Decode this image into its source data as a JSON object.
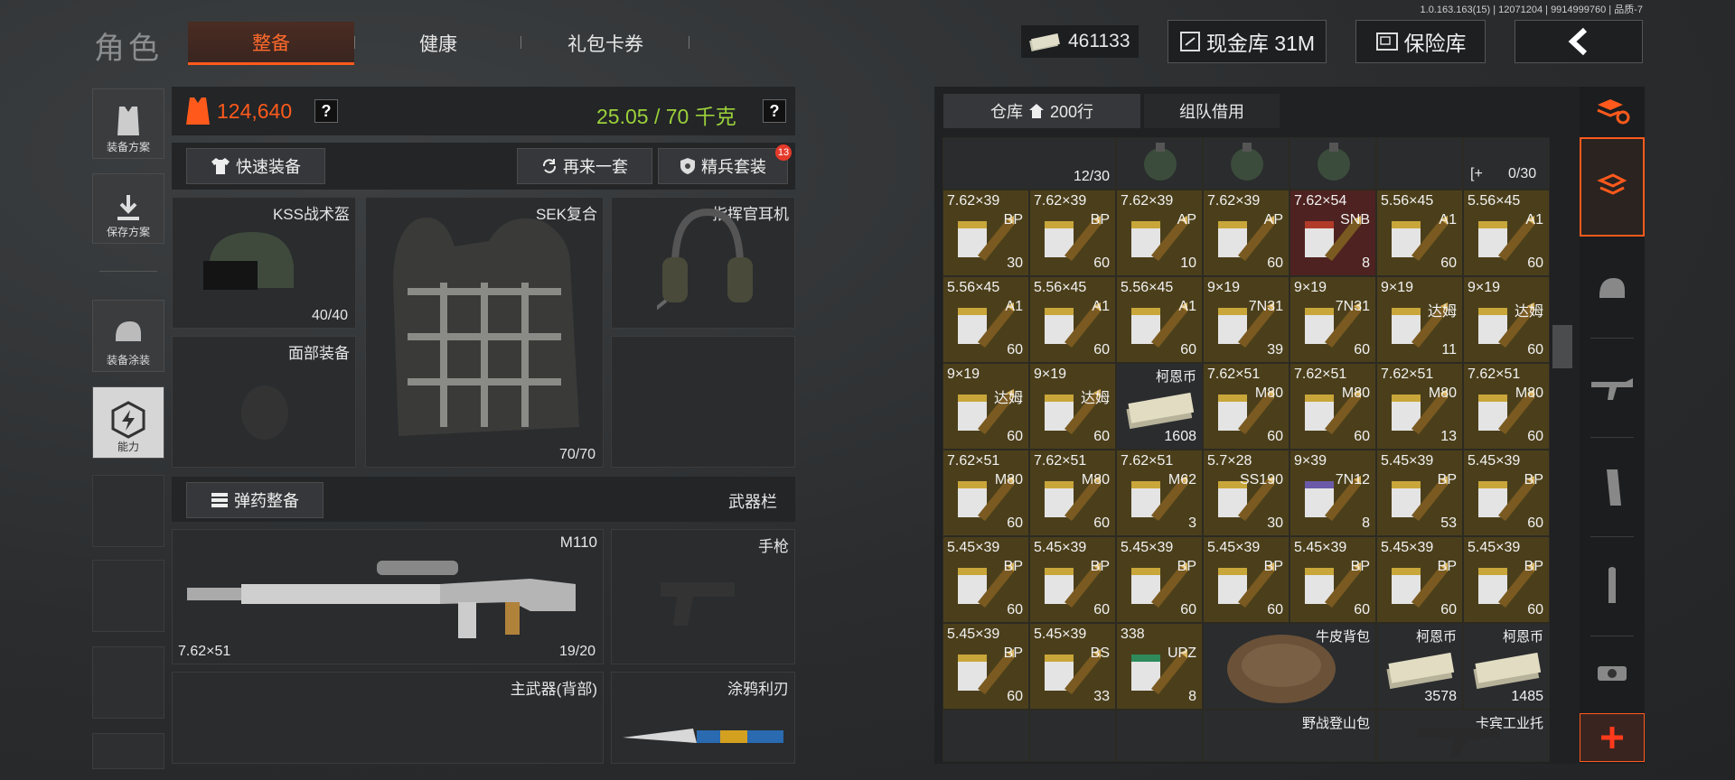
{
  "version": "1.0.163.163(15) | 12071204 | 9914999760 | 品质-7",
  "page_title": "角色",
  "tabs": [
    {
      "label": "整备",
      "active": true
    },
    {
      "label": "健康",
      "active": false
    },
    {
      "label": "礼包卡券",
      "active": false
    }
  ],
  "header": {
    "money": "461133",
    "cash_vault": "现金库 31M",
    "safe": "保险库"
  },
  "side_nav": [
    {
      "label": "装备方案",
      "icon": "vest-plan-icon"
    },
    {
      "label": "保存方案",
      "icon": "download-icon"
    },
    {
      "label": "装备涂装",
      "icon": "helmet-paint-icon"
    },
    {
      "label": "能力",
      "icon": "lightning-hex-icon"
    }
  ],
  "stats": {
    "armor_value": "124,640",
    "weight": "25.05 / 70 千克",
    "qmark": "?"
  },
  "actions": {
    "quick_equip": "快速装备",
    "again": "再来一套",
    "elite": "精兵套装",
    "elite_badge": "13",
    "ammo_equip": "弹药整备",
    "weapon_bar": "武器栏"
  },
  "slots": {
    "helmet": {
      "label": "KSS战术盔",
      "value": "40/40"
    },
    "armor": {
      "label": "SEK复合",
      "value": "70/70"
    },
    "headset": {
      "label": "指挥官耳机"
    },
    "face": {
      "label": "面部装备"
    },
    "primary": {
      "label": "M110",
      "ammo": "7.62×51",
      "value": "19/20"
    },
    "pistol": {
      "label": "手枪"
    },
    "back": {
      "label": "主武器(背部)"
    },
    "knife": {
      "label": "涂鸦利刃"
    }
  },
  "inventory": {
    "tab_storage": "仓库",
    "tab_rows": "200行",
    "tab_team": "组队借用",
    "top_row": [
      {
        "count": "12/30"
      },
      {
        "count": ""
      },
      {
        "count": ""
      },
      {
        "count": ""
      },
      {
        "count": ""
      },
      {
        "count": "0/30",
        "prefix": "[+"
      }
    ],
    "rows": [
      [
        {
          "cal": "7.62×39",
          "type": "BP",
          "count": "30",
          "color": "#c9a63a"
        },
        {
          "cal": "7.62×39",
          "type": "BP",
          "count": "60",
          "color": "#c9a63a"
        },
        {
          "cal": "7.62×39",
          "type": "AP",
          "count": "10",
          "color": "#c9a63a"
        },
        {
          "cal": "7.62×39",
          "type": "AP",
          "count": "60",
          "color": "#c9a63a"
        },
        {
          "cal": "7.62×54",
          "type": "SNB",
          "count": "8",
          "color": "#b23a2a",
          "red": true
        },
        {
          "cal": "5.56×45",
          "type": "A1",
          "count": "60",
          "color": "#c9a63a"
        },
        {
          "cal": "5.56×45",
          "type": "A1",
          "count": "60",
          "color": "#c9a63a"
        }
      ],
      [
        {
          "cal": "5.56×45",
          "type": "A1",
          "count": "60",
          "color": "#c9a63a"
        },
        {
          "cal": "5.56×45",
          "type": "A1",
          "count": "60",
          "color": "#c9a63a"
        },
        {
          "cal": "5.56×45",
          "type": "A1",
          "count": "60",
          "color": "#c9a63a"
        },
        {
          "cal": "9×19",
          "type": "7N31",
          "count": "39",
          "color": "#c9a63a"
        },
        {
          "cal": "9×19",
          "type": "7N31",
          "count": "60",
          "color": "#c9a63a"
        },
        {
          "cal": "9×19",
          "type": "达姆",
          "count": "11",
          "color": "#c9a63a"
        },
        {
          "cal": "9×19",
          "type": "达姆",
          "count": "60",
          "color": "#c9a63a"
        }
      ],
      [
        {
          "cal": "9×19",
          "type": "达姆",
          "count": "60",
          "color": "#c9a63a"
        },
        {
          "cal": "9×19",
          "type": "达姆",
          "count": "60",
          "color": "#c9a63a"
        },
        {
          "title": "柯恩币",
          "count": "1608",
          "cash": true
        },
        {
          "cal": "7.62×51",
          "type": "M80",
          "count": "60",
          "color": "#c9a63a"
        },
        {
          "cal": "7.62×51",
          "type": "M80",
          "count": "60",
          "color": "#c9a63a"
        },
        {
          "cal": "7.62×51",
          "type": "M80",
          "count": "13",
          "color": "#c9a63a"
        },
        {
          "cal": "7.62×51",
          "type": "M80",
          "count": "60",
          "color": "#c9a63a"
        }
      ],
      [
        {
          "cal": "7.62×51",
          "type": "M80",
          "count": "60",
          "color": "#c9a63a"
        },
        {
          "cal": "7.62×51",
          "type": "M80",
          "count": "60",
          "color": "#c9a63a"
        },
        {
          "cal": "7.62×51",
          "type": "M62",
          "count": "3",
          "color": "#c9a63a"
        },
        {
          "cal": "5.7×28",
          "type": "SS190",
          "count": "30",
          "color": "#c9a63a"
        },
        {
          "cal": "9×39",
          "type": "7N12",
          "count": "8",
          "color": "#6b5aa8"
        },
        {
          "cal": "5.45×39",
          "type": "BP",
          "count": "53",
          "color": "#c9a63a"
        },
        {
          "cal": "5.45×39",
          "type": "BP",
          "count": "60",
          "color": "#c9a63a"
        }
      ],
      [
        {
          "cal": "5.45×39",
          "type": "BP",
          "count": "60",
          "color": "#c9a63a"
        },
        {
          "cal": "5.45×39",
          "type": "BP",
          "count": "60",
          "color": "#c9a63a"
        },
        {
          "cal": "5.45×39",
          "type": "BP",
          "count": "60",
          "color": "#c9a63a"
        },
        {
          "cal": "5.45×39",
          "type": "BP",
          "count": "60",
          "color": "#c9a63a"
        },
        {
          "cal": "5.45×39",
          "type": "BP",
          "count": "60",
          "color": "#c9a63a"
        },
        {
          "cal": "5.45×39",
          "type": "BP",
          "count": "60",
          "color": "#c9a63a"
        },
        {
          "cal": "5.45×39",
          "type": "BP",
          "count": "60",
          "color": "#c9a63a"
        }
      ],
      [
        {
          "cal": "5.45×39",
          "type": "BP",
          "count": "60",
          "color": "#c9a63a"
        },
        {
          "cal": "5.45×39",
          "type": "BS",
          "count": "33",
          "color": "#c9a63a"
        },
        {
          "cal": "338",
          "type": "UPZ",
          "count": "8",
          "color": "#2e8a5a",
          "green": true
        },
        {
          "title": "牛皮背包",
          "backpack": true
        },
        {
          "title": "柯恩币",
          "count": "3578",
          "cash": true
        },
        {
          "title": "柯恩币",
          "count": "1485",
          "cash": true
        }
      ]
    ],
    "bottom_labels": {
      "bag": "野战登山包",
      "stock": "卡宾工业托"
    }
  },
  "inv_sidebar": [
    "stack-refresh-icon",
    "armor-layers-icon",
    "helmet-icon",
    "rifle-icon",
    "magazine-icon",
    "bullet-icon",
    "scope-icon",
    "plus-icon"
  ],
  "colors": {
    "accent": "#ff5a1c",
    "weight_green": "#9bd13a",
    "ammo_bg": "#4b3f1b"
  }
}
